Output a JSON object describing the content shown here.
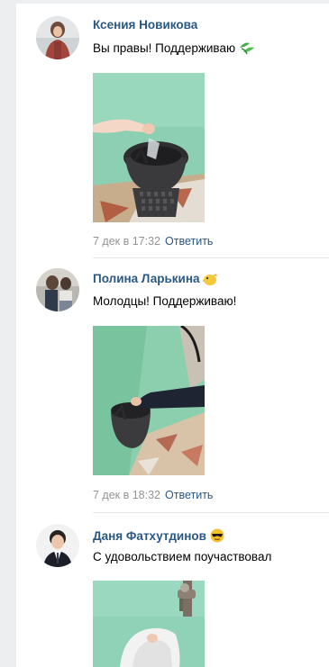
{
  "comments": [
    {
      "author": "Ксения Новикова",
      "author_emoji": "",
      "text": "Вы правы! Поддерживаю",
      "text_emoji": "seedling-icon",
      "date": "7 дек в 17:32",
      "reply_label": "Ответить"
    },
    {
      "author": "Полина Ларькина",
      "author_emoji": "chick-emoji",
      "text": "Молодцы! Поддерживаю!",
      "text_emoji": "",
      "date": "7 дек в 18:32",
      "reply_label": "Ответить"
    },
    {
      "author": "Даня Фатхутдинов",
      "author_emoji": "sunglasses-emoji",
      "text": "С удовольствием поучаствовал",
      "text_emoji": "",
      "date": "",
      "reply_label": ""
    }
  ],
  "colors": {
    "page_bg": "#edeef0",
    "panel_bg": "#ffffff",
    "link": "#2a5885",
    "meta": "#939393",
    "wall_green": "#8fd1b4"
  }
}
